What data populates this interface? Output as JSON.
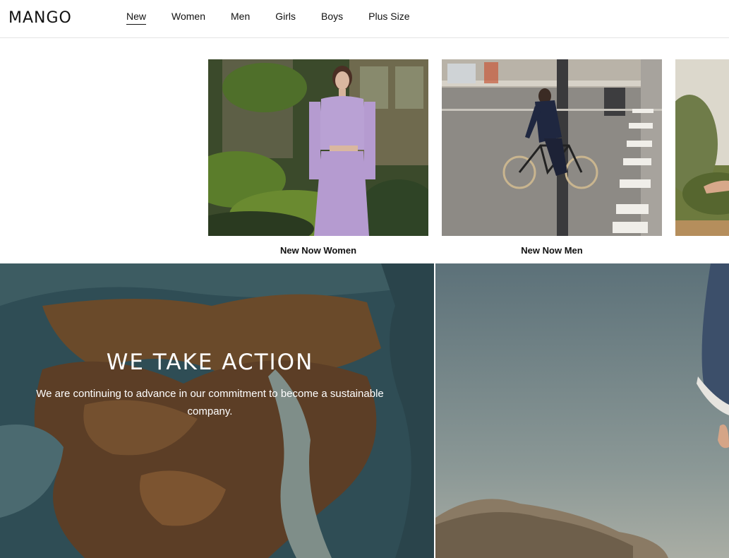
{
  "brand": {
    "logo_text": "MANGO"
  },
  "nav": {
    "items": [
      {
        "label": "New",
        "active": true
      },
      {
        "label": "Women"
      },
      {
        "label": "Men"
      },
      {
        "label": "Girls"
      },
      {
        "label": "Boys"
      },
      {
        "label": "Plus Size"
      }
    ]
  },
  "carousel": {
    "cards": [
      {
        "caption": "New Now Women",
        "image": "woman-lilac-knit-set-garden-photo"
      },
      {
        "caption": "New Now Men",
        "image": "man-cycling-street-photo"
      },
      {
        "caption": "",
        "image": "outdoor-trees-partial-photo"
      }
    ]
  },
  "hero": {
    "title": "WE TAKE ACTION",
    "subtitle": "We are continuing to advance in our commitment to become a sustainable company.",
    "image": "aerial-coastline-photo"
  },
  "side_panel": {
    "image": "sky-and-dry-grass-photo"
  }
}
